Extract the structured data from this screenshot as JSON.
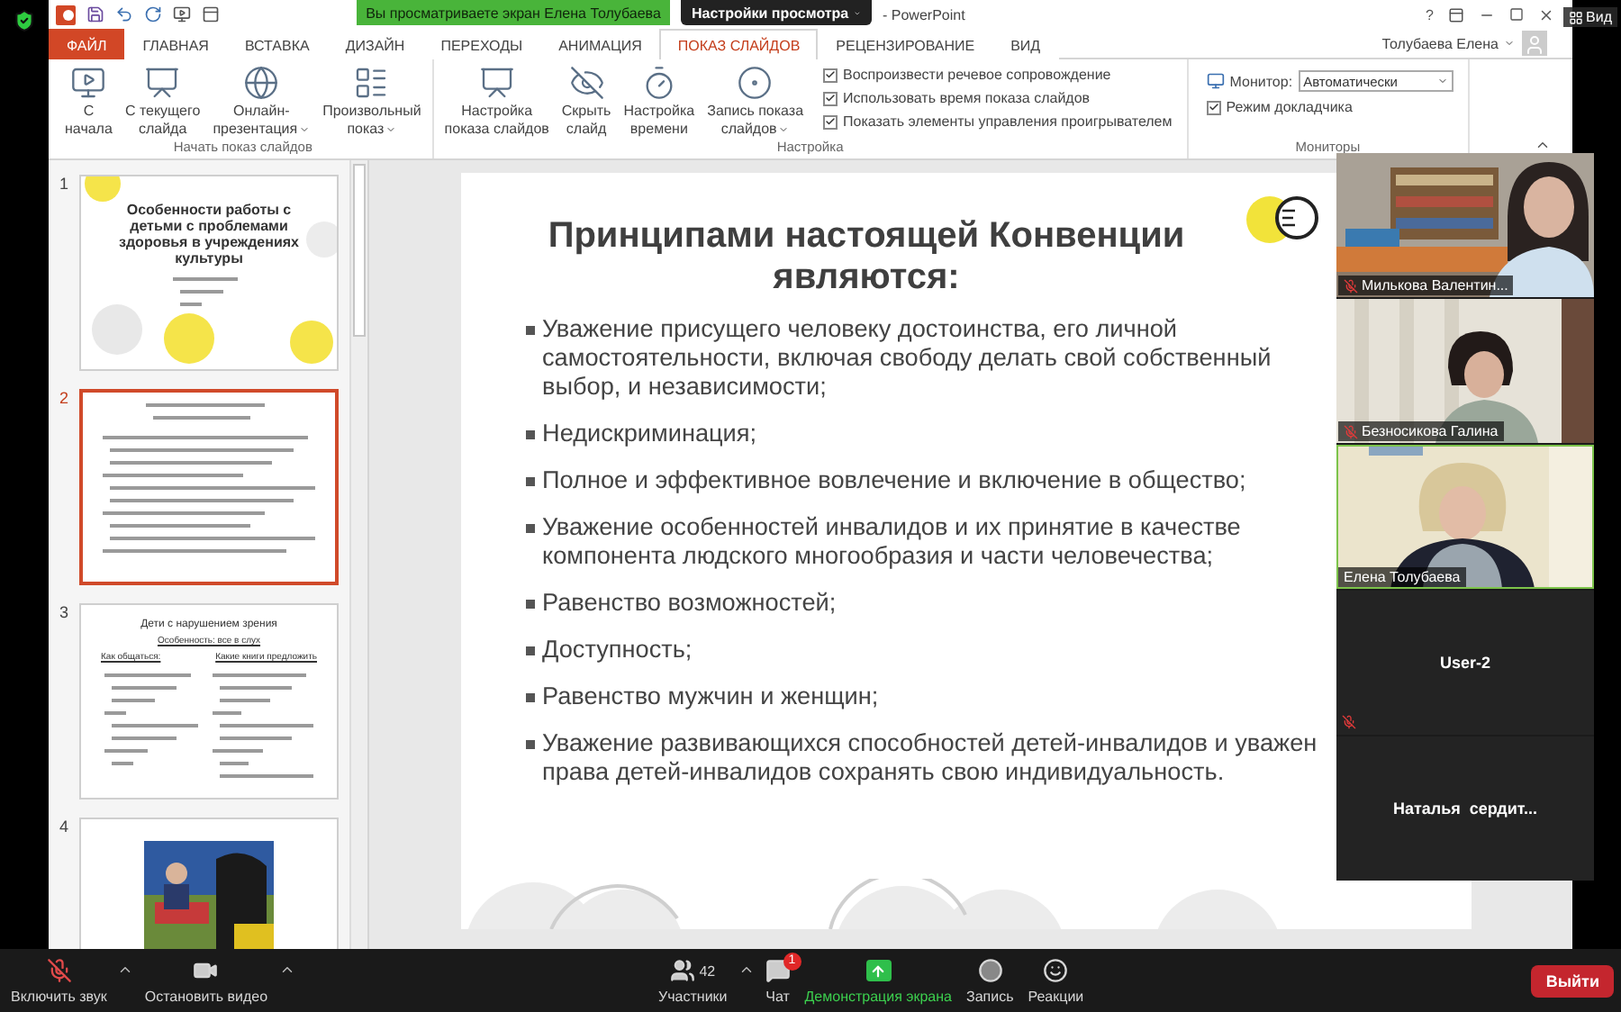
{
  "zoom_banner": {
    "text": "Вы просматриваете экран Елена Толубаева",
    "options": "Настройки просмотра"
  },
  "view_button": "Вид",
  "powerpoint": {
    "title": "- PowerPoint",
    "help": "?",
    "user": "Толубаева Елена",
    "tabs": [
      {
        "label": "ФАЙЛ",
        "kind": "file",
        "selected": false
      },
      {
        "label": "ГЛАВНАЯ",
        "kind": "tab",
        "selected": false
      },
      {
        "label": "ВСТАВКА",
        "kind": "tab",
        "selected": false
      },
      {
        "label": "ДИЗАЙН",
        "kind": "tab",
        "selected": false
      },
      {
        "label": "ПЕРЕХОДЫ",
        "kind": "tab",
        "selected": false
      },
      {
        "label": "АНИМАЦИЯ",
        "kind": "tab",
        "selected": false
      },
      {
        "label": "ПОКАЗ СЛАЙДОВ",
        "kind": "tab",
        "selected": true
      },
      {
        "label": "РЕЦЕНЗИРОВАНИЕ",
        "kind": "tab",
        "selected": false
      },
      {
        "label": "ВИД",
        "kind": "tab",
        "selected": false
      }
    ],
    "ribbon": {
      "groups": [
        {
          "label": "Начать показ слайдов",
          "items": [
            {
              "kind": "button",
              "lines": [
                "С",
                "начала"
              ],
              "dropdown": false
            },
            {
              "kind": "button",
              "lines": [
                "С текущего",
                "слайда"
              ],
              "dropdown": false
            },
            {
              "kind": "button",
              "lines": [
                "Онлайн-",
                "презентация"
              ],
              "dropdown": true
            },
            {
              "kind": "button",
              "lines": [
                "Произвольный",
                "показ"
              ],
              "dropdown": true
            }
          ]
        },
        {
          "label": "Настройка",
          "items": [
            {
              "kind": "button",
              "lines": [
                "Настройка",
                "показа слайдов"
              ],
              "dropdown": false
            },
            {
              "kind": "button",
              "lines": [
                "Скрыть",
                "слайд"
              ],
              "dropdown": false
            },
            {
              "kind": "button",
              "lines": [
                "Настройка",
                "времени"
              ],
              "dropdown": false
            },
            {
              "kind": "button",
              "lines": [
                "Запись показа",
                "слайдов"
              ],
              "dropdown": true
            },
            {
              "kind": "checks",
              "checks": [
                {
                  "label": "Воспроизвести речевое сопровождение",
                  "checked": true
                },
                {
                  "label": "Использовать время показа слайдов",
                  "checked": true
                },
                {
                  "label": "Показать элементы управления проигрывателем",
                  "checked": true
                }
              ]
            }
          ]
        },
        {
          "label": "Мониторы",
          "items": [
            {
              "kind": "monitor",
              "label": "Монитор:",
              "value": "Автоматически",
              "checks": [
                {
                  "label": "Режим докладчика",
                  "checked": true
                }
              ]
            }
          ]
        }
      ]
    },
    "thumbnails": [
      {
        "number": "1",
        "selected": false,
        "kind": "title",
        "title": "Особенности работы с детьми с проблемами здоровья в учреждениях культуры"
      },
      {
        "number": "2",
        "selected": true,
        "kind": "text"
      },
      {
        "number": "3",
        "selected": false,
        "kind": "columns",
        "title": "Дети с нарушением зрения",
        "subtitle": "Особенность: все в слух",
        "columns": [
          "Как общаться:",
          "Какие книги предложить"
        ]
      },
      {
        "number": "4",
        "selected": false
      }
    ],
    "slide": {
      "title_lines": [
        "Принципами настоящей Конвенции",
        "являются:"
      ],
      "bullets": [
        {
          "lines": [
            "Уважение присущего человеку достоинства, его личной",
            "самостоятельности, включая свободу делать свой собственный",
            "выбор, и независимости;"
          ]
        },
        {
          "lines": [
            "Недискриминация;"
          ]
        },
        {
          "lines": [
            "Полное и эффективное вовлечение и включение в общество;"
          ]
        },
        {
          "lines": [
            "Уважение особенностей инвалидов и их принятие в качестве",
            "компонента людского многообразия и части человечества;"
          ]
        },
        {
          "lines": [
            "Равенство возможностей;"
          ]
        },
        {
          "lines": [
            "Доступность;"
          ]
        },
        {
          "lines": [
            "Равенство мужчин и женщин;"
          ]
        },
        {
          "lines": [
            "Уважение развивающихся способностей детей-инвалидов и уважен",
            "права детей-инвалидов сохранять свою индивидуальность."
          ]
        }
      ]
    }
  },
  "participants": [
    {
      "kind": "video",
      "name": "Милькова Валентин...",
      "muted": true,
      "speaking": false
    },
    {
      "kind": "video",
      "name": "Безносикова Галина",
      "muted": true,
      "speaking": false
    },
    {
      "kind": "video",
      "name": "Елена Толубаева",
      "muted": false,
      "speaking": true
    },
    {
      "kind": "name_only",
      "name": "User-2",
      "muted": true,
      "speaking": false
    },
    {
      "kind": "name_only",
      "name": "Наталья  сердит...",
      "muted": false,
      "speaking": false
    }
  ],
  "toolbar": {
    "items": [
      {
        "kind": "mic",
        "label": "Включить звук",
        "menu": true,
        "active": false
      },
      {
        "kind": "video",
        "label": "Остановить видео",
        "menu": true,
        "active": false
      },
      {
        "kind": "participants",
        "label": "Участники",
        "count": "42",
        "menu": true,
        "active": false
      },
      {
        "kind": "chat",
        "label": "Чат",
        "badge": "1",
        "menu": false,
        "active": false
      },
      {
        "kind": "share",
        "label": "Демонстрация экрана",
        "menu": false,
        "active": true
      },
      {
        "kind": "record",
        "label": "Запись",
        "menu": false,
        "active": false
      },
      {
        "kind": "reactions",
        "label": "Реакции",
        "menu": false,
        "active": false
      }
    ],
    "leave": "Выйти"
  }
}
